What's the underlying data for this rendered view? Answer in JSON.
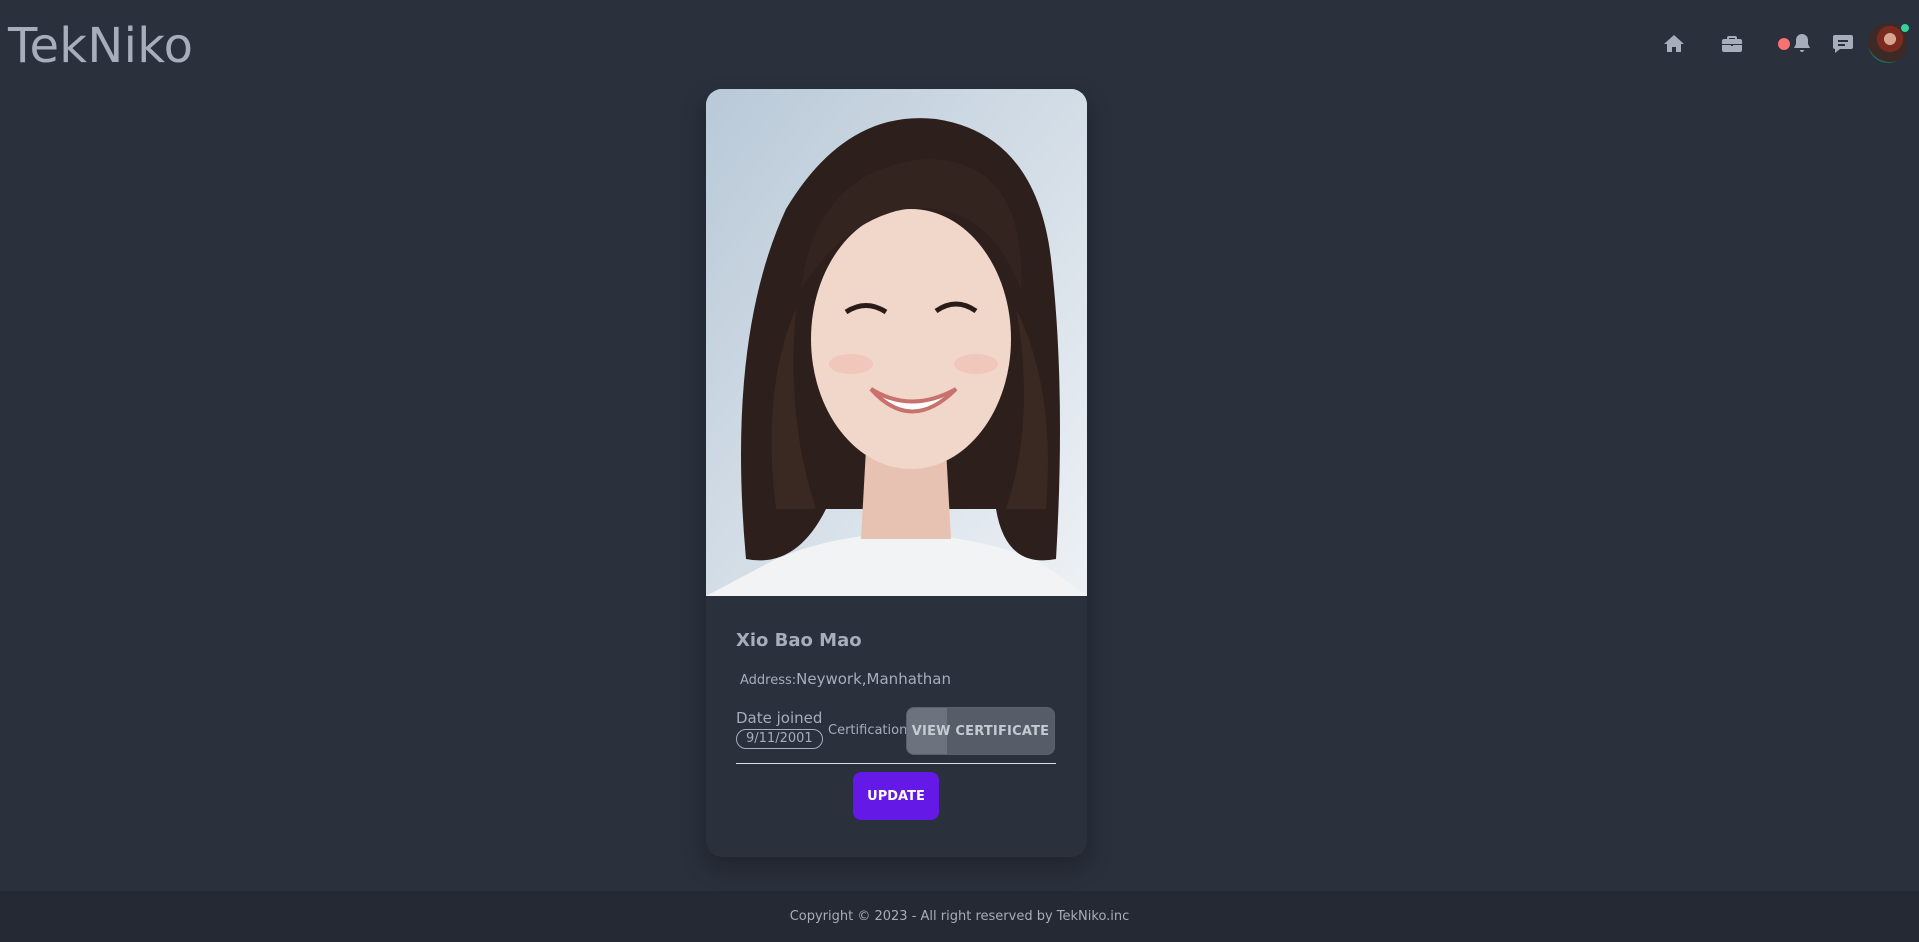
{
  "navbar": {
    "brand": "TekNiko",
    "icons": {
      "home": "home-icon",
      "jobs": "briefcase-icon",
      "notifications": "bell-icon",
      "messages": "chat-icon"
    },
    "notification_dot_color": "#f87272",
    "online_dot_color": "#36d399"
  },
  "profile": {
    "name": "Xio Bao Mao",
    "address_label": "Address:",
    "address_value": "Neywork,Manhathan",
    "date_joined_label": "Date joined",
    "date_joined_value": "9/11/2001",
    "certification_label": "Certification",
    "view_certificate_label": "VIEW CERTIFICATE",
    "update_label": "UPDATE"
  },
  "colors": {
    "background": "#2a303c",
    "footer_background": "#242933",
    "text": "#a6adbb",
    "primary": "#6419e6"
  },
  "footer": {
    "copyright": "Copyright © 2023 - All right reserved by TekNiko.inc"
  }
}
